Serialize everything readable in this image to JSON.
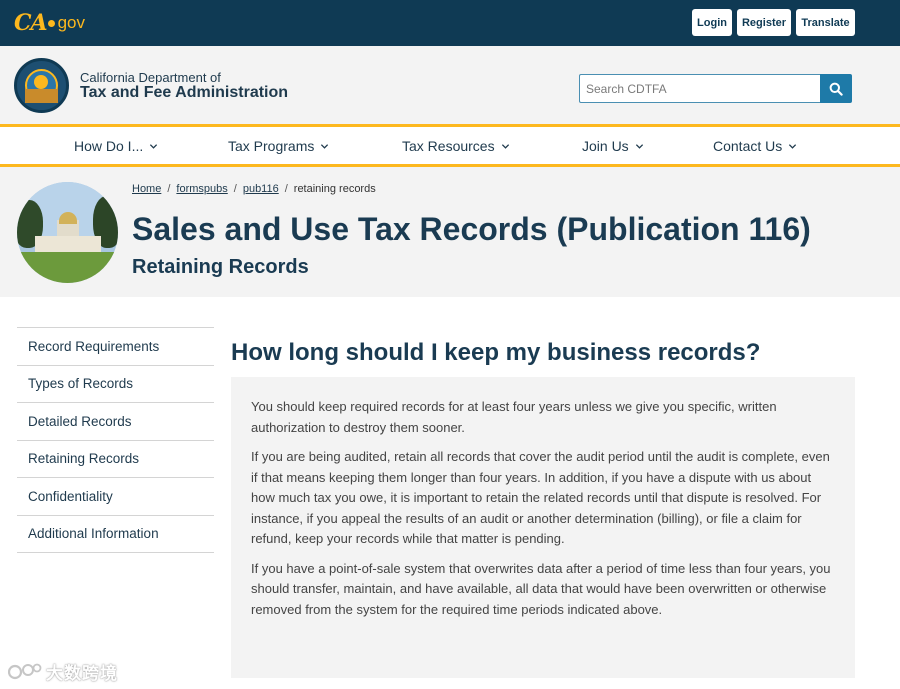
{
  "topbar": {
    "logo_ca": "CA",
    "logo_gov": "gov",
    "login_label": "Login",
    "register_label": "Register",
    "translate_label": "Translate"
  },
  "header": {
    "department_line1": "California Department of",
    "department_line2": "Tax and Fee Administration",
    "search_placeholder": "Search CDTFA"
  },
  "nav": {
    "items": [
      {
        "label": "How Do I..."
      },
      {
        "label": "Tax Programs"
      },
      {
        "label": "Tax Resources"
      },
      {
        "label": "Join Us"
      },
      {
        "label": "Contact Us"
      }
    ]
  },
  "hero": {
    "breadcrumb": [
      "Home",
      "formspubs",
      "pub116",
      "retaining records"
    ],
    "title": "Sales and Use Tax Records (Publication 116)",
    "subtitle": "Retaining Records"
  },
  "sidebar": {
    "items": [
      {
        "label": "Record Requirements"
      },
      {
        "label": "Types of Records"
      },
      {
        "label": "Detailed Records"
      },
      {
        "label": "Retaining Records"
      },
      {
        "label": "Confidentiality"
      },
      {
        "label": "Additional Information"
      }
    ]
  },
  "main": {
    "heading": "How long should I keep my business records?",
    "paragraphs": [
      "You should keep required records for at least four years unless we give you specific, written authorization to destroy them sooner.",
      "If you are being audited, retain all records that cover the audit period until the audit is complete, even if that means keeping them longer than four years. In addition, if you have a dispute with us about how much tax you owe, it is important to retain the related records until that dispute is resolved. For instance, if you appeal the results of an audit or another determination (billing), or file a claim for refund, keep your records while that matter is pending.",
      "If you have a point-of-sale system that overwrites data after a period of time less than four years, you should transfer, maintain, and have available, all data that would have been overwritten or otherwise removed from the system for the required time periods indicated above."
    ]
  },
  "watermark": {
    "text": "大数跨境"
  },
  "colors": {
    "topbar_bg": "#0f3a54",
    "accent_gold": "#fdb81e",
    "search_button": "#1e7aa8",
    "panel_bg": "#f3f3f3"
  },
  "icons": {
    "search": "search-icon",
    "nav_chevron": "chevron-down-icon"
  }
}
